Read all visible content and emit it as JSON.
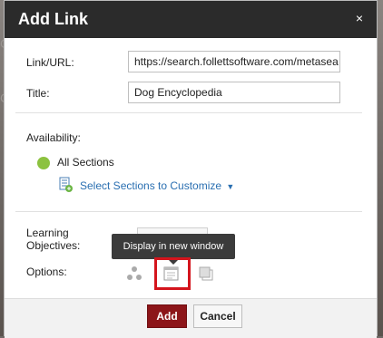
{
  "dialog": {
    "title": "Add Link",
    "close_glyph": "×"
  },
  "form": {
    "link_label": "Link/URL:",
    "link_value": "https://search.follettsoftware.com/metasea",
    "title_label": "Title:",
    "title_value": "Dog Encyclopedia",
    "availability_label": "Availability:",
    "all_sections_label": "All Sections",
    "select_sections_link": "Select Sections to Customize",
    "learning_objectives_line1": "Learning",
    "learning_objectives_line2": "Objectives:",
    "options_label": "Options:"
  },
  "tooltip": {
    "text": "Display in new window"
  },
  "footer": {
    "add_label": "Add",
    "cancel_label": "Cancel"
  },
  "colors": {
    "titlebar": "#2b2b2b",
    "add_button": "#8c1519",
    "all_sections_dot": "#8cc23f",
    "link": "#2a6fb1",
    "highlight": "#d4151d"
  },
  "icons": {
    "sections": "section-list-icon",
    "dropdown": "caret-down-icon",
    "option1": "share-icon",
    "option2": "new-window-icon",
    "option3": "copy-icon"
  }
}
